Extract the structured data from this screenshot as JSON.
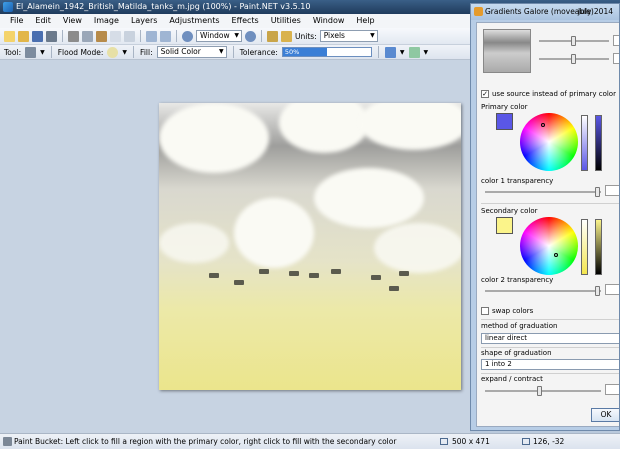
{
  "window": {
    "title": "El_Alamein_1942_British_Matilda_tanks_m.jpg (100%) - Paint.NET v3.5.10"
  },
  "menu": [
    "File",
    "Edit",
    "View",
    "Image",
    "Layers",
    "Adjustments",
    "Effects",
    "Utilities",
    "Window",
    "Help"
  ],
  "toolbar": {
    "window_combo": "Window",
    "units_label": "Units:",
    "units_value": "Pixels"
  },
  "tool_options": {
    "tool_label": "Tool:",
    "flood_mode_label": "Flood Mode:",
    "fill_label": "Fill:",
    "fill_value": "Solid Color",
    "tolerance_label": "Tolerance:",
    "tolerance_value": "50%",
    "tolerance_fraction": 0.5
  },
  "status": {
    "message": "Paint Bucket: Left click to fill a region with the primary color, right click to fill with the secondary color",
    "image_size": "500 x 471",
    "cursor_pos": "126, -32"
  },
  "dialog": {
    "title": "Gradients Galore (moveable)",
    "date": "July 2014",
    "use_source_label": "use source instead of primary color",
    "use_source_checked": true,
    "primary_color_label": "Primary color",
    "primary_color": "#5a57e6",
    "color1_transparency_label": "color 1 transparency",
    "secondary_color_label": "Secondary color",
    "secondary_color": "#fbf48a",
    "color2_transparency_label": "color 2 transparency",
    "swap_colors_label": "swap colors",
    "swap_colors_checked": false,
    "method_label": "method of graduation",
    "method_value": "linear direct",
    "shape_label": "shape of graduation",
    "shape_value": "1 into 2",
    "expand_label": "expand / contract",
    "ok_label": "OK"
  },
  "colors": {
    "accent": "#3b7fd6",
    "titlebar": "#1f3b5c",
    "workspace": "#c7d3e2"
  }
}
